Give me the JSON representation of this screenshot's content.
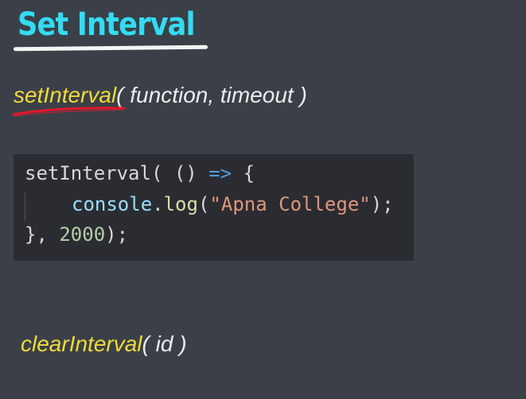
{
  "slide": {
    "title": "Set Interval"
  },
  "set_interval_signature": {
    "fn_name": "setInterval",
    "params": "( function, timeout )"
  },
  "code_example": {
    "line1": {
      "fn": "setInterval",
      "open": "( ",
      "parens": "()",
      "arrow": " =>",
      "brace": " {"
    },
    "line2": {
      "object": "console",
      "dot": ".",
      "method": "log",
      "open": "(",
      "string": "\"Apna College\"",
      "close": ");"
    },
    "line3": {
      "close_brace": "}, ",
      "delay": "2000",
      "close": ");"
    }
  },
  "clear_interval_signature": {
    "fn_name": "clearInterval",
    "params": "( id )"
  },
  "colors": {
    "background": "#3b4048",
    "title": "#33dcf2",
    "function_name": "#eedb3b",
    "code_background": "#2a2c31",
    "annotation_red": "#e0182b"
  }
}
